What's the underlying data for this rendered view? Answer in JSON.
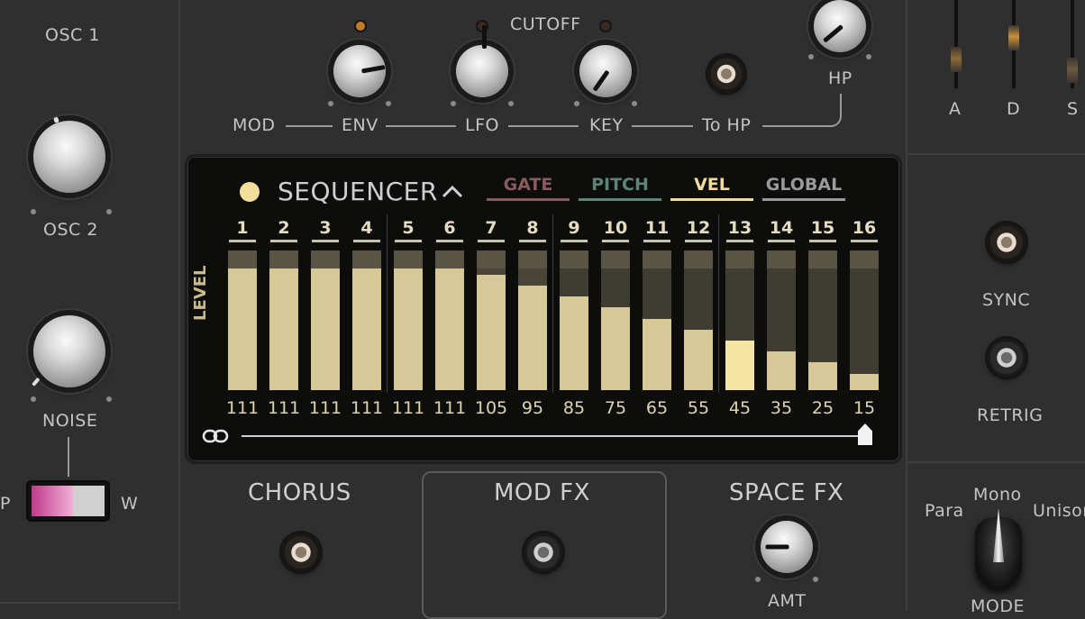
{
  "left": {
    "osc1_label": "OSC 1",
    "osc2_label": "OSC 2",
    "noise_label": "NOISE",
    "switch_left": "P",
    "switch_right": "W"
  },
  "filter": {
    "cutoff_label": "CUTOFF",
    "hp_label": "HP",
    "mod_label": "MOD",
    "env_label": "ENV",
    "lfo_label": "LFO",
    "key_label": "KEY",
    "to_hp_label": "To HP"
  },
  "envelope": {
    "a": "A",
    "d": "D",
    "s": "S"
  },
  "right": {
    "sync_label": "SYNC",
    "retrig_label": "RETRIG",
    "para_label": "Para",
    "mono_label": "Mono",
    "unison_label": "Unison",
    "mode_label": "MODE"
  },
  "sequencer": {
    "title": "SEQUENCER",
    "chevron": "^",
    "level_label": "LEVEL",
    "tabs": [
      {
        "label": "GATE",
        "color": "#8a5a5e"
      },
      {
        "label": "PITCH",
        "color": "#5e8478"
      },
      {
        "label": "VEL",
        "color": "#f0dc98"
      },
      {
        "label": "GLOBAL",
        "color": "#9a9a9a"
      }
    ],
    "active_tab": "VEL",
    "steps": [
      "1",
      "2",
      "3",
      "4",
      "5",
      "6",
      "7",
      "8",
      "9",
      "10",
      "11",
      "12",
      "13",
      "14",
      "15",
      "16"
    ],
    "values": [
      "111",
      "111",
      "111",
      "111",
      "111",
      "111",
      "105",
      "95",
      "85",
      "75",
      "65",
      "55",
      "45",
      "35",
      "25",
      "15"
    ],
    "levels": [
      111,
      111,
      111,
      111,
      111,
      111,
      105,
      95,
      85,
      75,
      65,
      55,
      45,
      35,
      25,
      15
    ],
    "max_level": 127,
    "selected_step": 13
  },
  "effects": {
    "chorus": "CHORUS",
    "mod_fx": "MOD FX",
    "space_fx": "SPACE FX",
    "amt": "AMT"
  }
}
